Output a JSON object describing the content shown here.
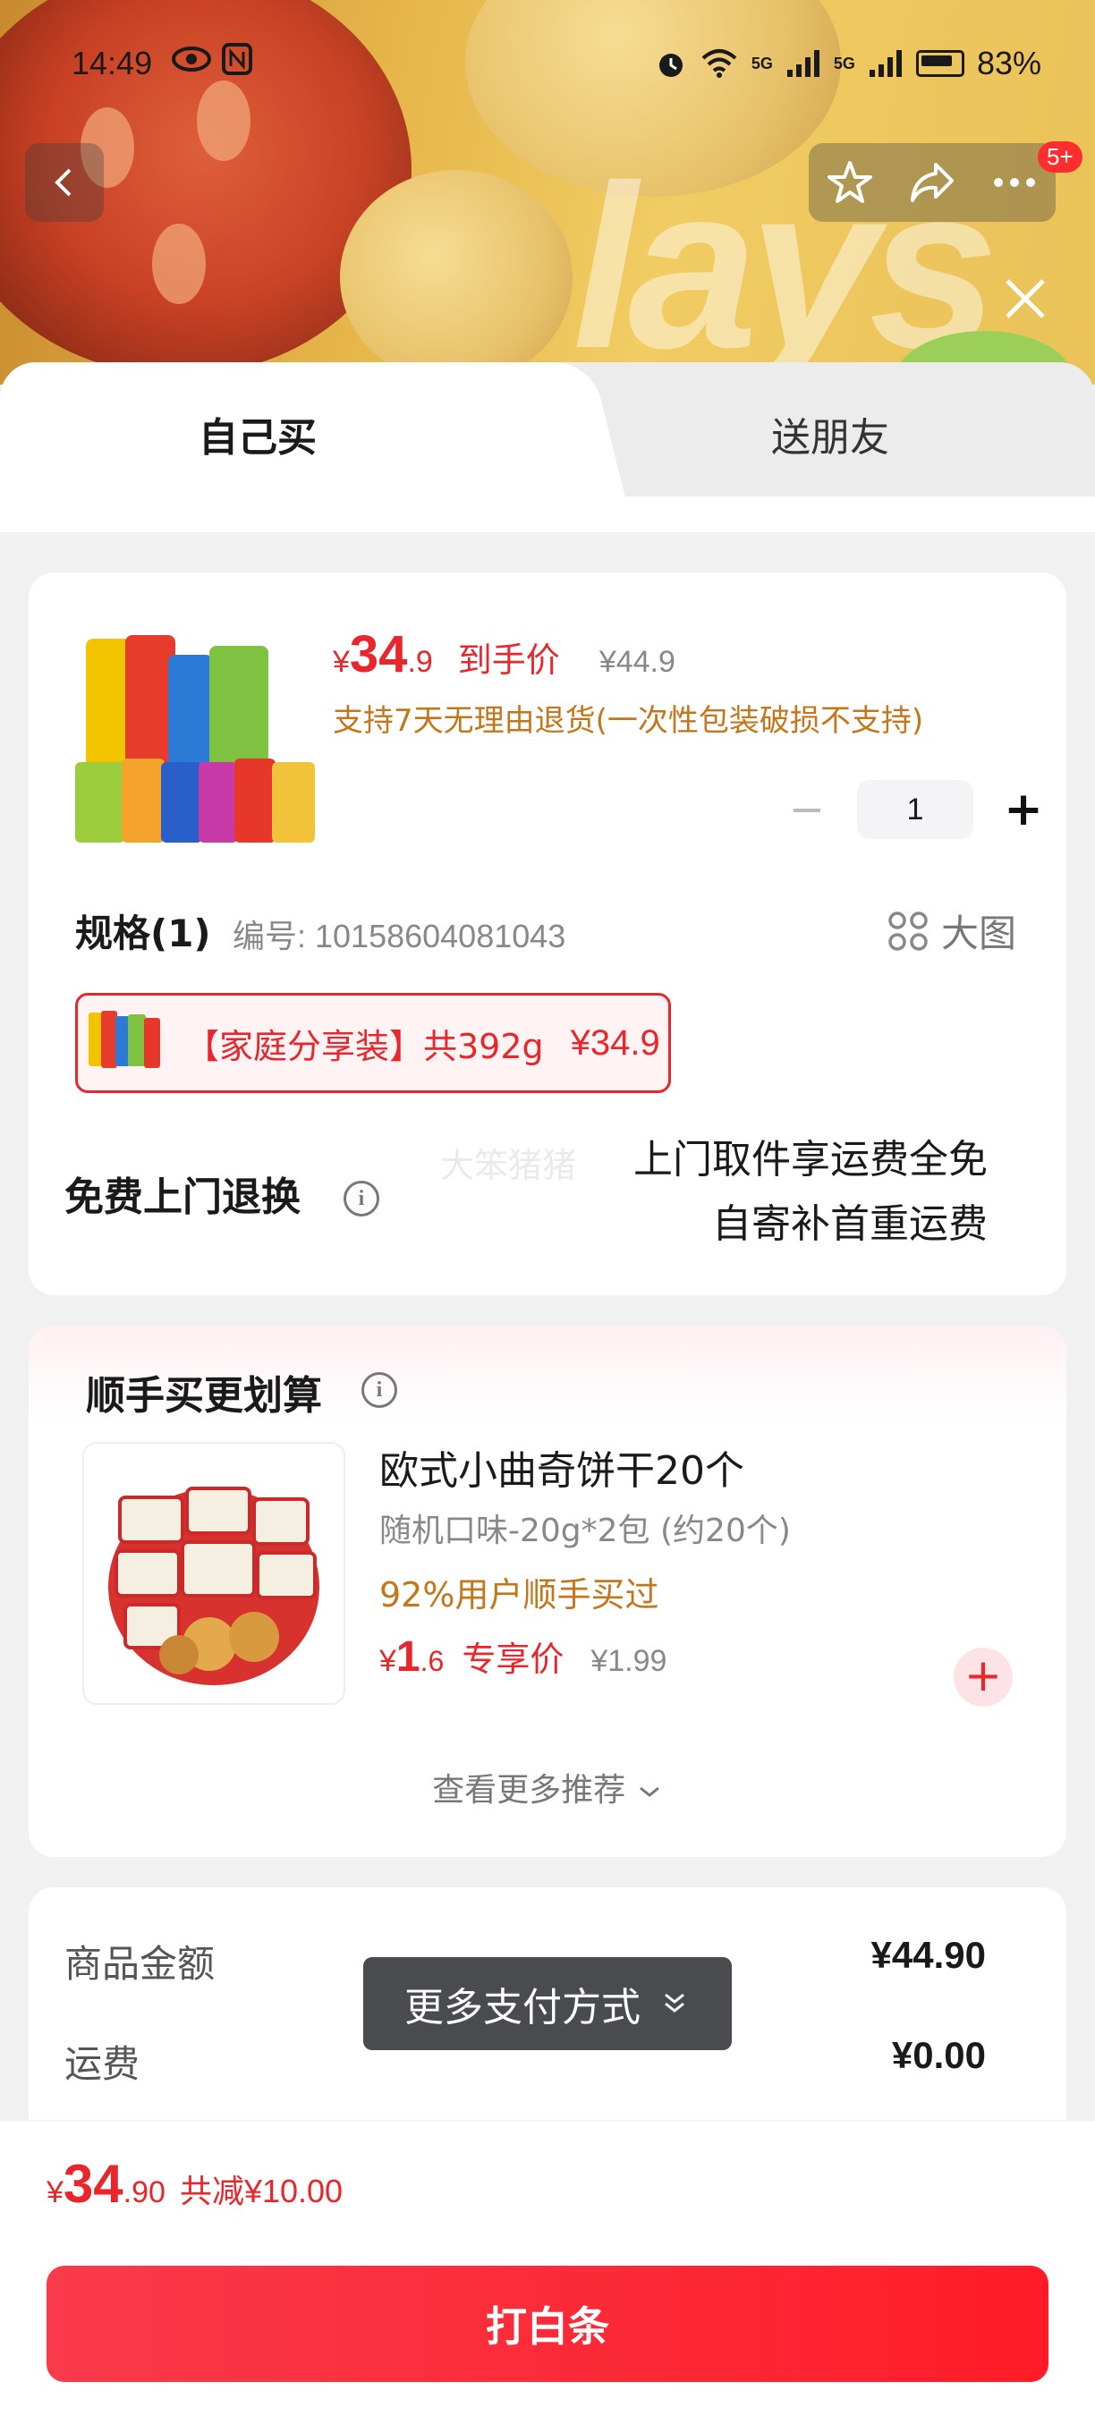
{
  "status_bar": {
    "time": "14:49",
    "network_1": "5G",
    "network_2": "5G",
    "battery": "83%"
  },
  "nav": {
    "badge": "5+"
  },
  "tabs": [
    {
      "label": "自己买",
      "active": true
    },
    {
      "label": "送朋友",
      "active": false
    }
  ],
  "product": {
    "price_symbol": "¥",
    "price_int": "34",
    "price_dec": ".9",
    "price_tag": "到手价",
    "original_price": "¥44.9",
    "refund_note": "支持7天无理由退货(一次性包装破损不支持)",
    "quantity": "1",
    "minus_symbol": "−",
    "plus_symbol": "+"
  },
  "spec": {
    "title": "规格(1)",
    "code": "编号: 10158604081043",
    "big_image_label": "大图",
    "option_label": "【家庭分享装】共392g",
    "option_price": "¥34.9"
  },
  "return_service": {
    "title": "免费上门退换",
    "watermark": "大笨猪猪",
    "line1": "上门取件享运费全免",
    "line2": "自寄补首重运费"
  },
  "addon": {
    "title": "顺手买更划算",
    "item": {
      "name": "欧式小曲奇饼干20个",
      "spec": "随机口味-20g*2包 (约20个)",
      "bought": "92%用户顺手买过",
      "price_symbol": "¥",
      "price_int": "1",
      "price_dec": ".6",
      "price_tag": "专享价",
      "original_price": "¥1.99"
    },
    "see_more": "查看更多推荐"
  },
  "totals": [
    {
      "label": "商品金额",
      "value": "¥44.90"
    },
    {
      "label": "运费",
      "value": "¥0.00"
    }
  ],
  "toast": {
    "label": "更多支付方式"
  },
  "bottom": {
    "price_symbol": "¥",
    "price_int": "34",
    "price_dec": ".90",
    "discount": "共减¥10.00",
    "pay_button": "打白条"
  },
  "colors": {
    "accent_red": "#e8262c",
    "orange_note": "#c4761b",
    "toast_bg": "#4a4b4f"
  }
}
